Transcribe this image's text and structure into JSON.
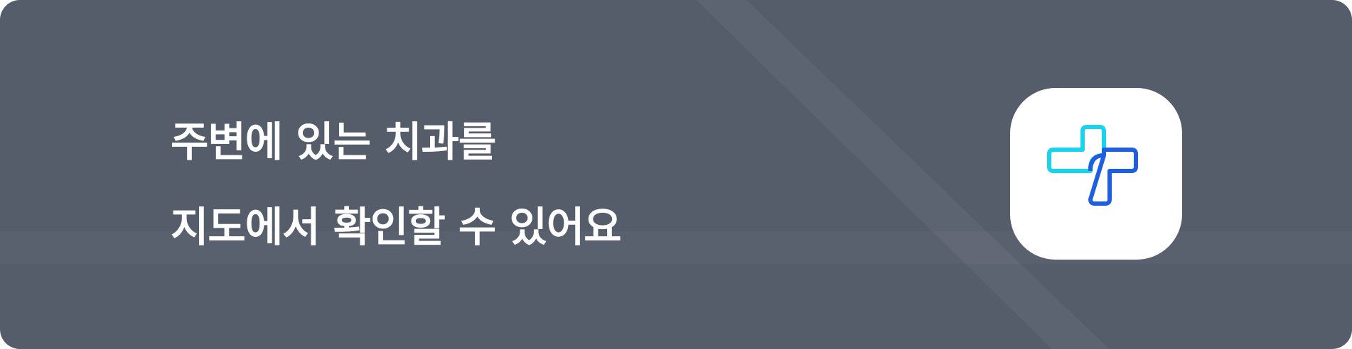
{
  "banner": {
    "title_lines": [
      "주변에 있는 치과를",
      "지도에서 확인할 수 있어요"
    ],
    "icon": "dental-cross-icon"
  },
  "colors": {
    "background": "#555c6a",
    "text": "#ffffff",
    "icon_background": "#ffffff",
    "icon_cyan": "#18d2ee",
    "icon_blue": "#1e5fe0"
  }
}
